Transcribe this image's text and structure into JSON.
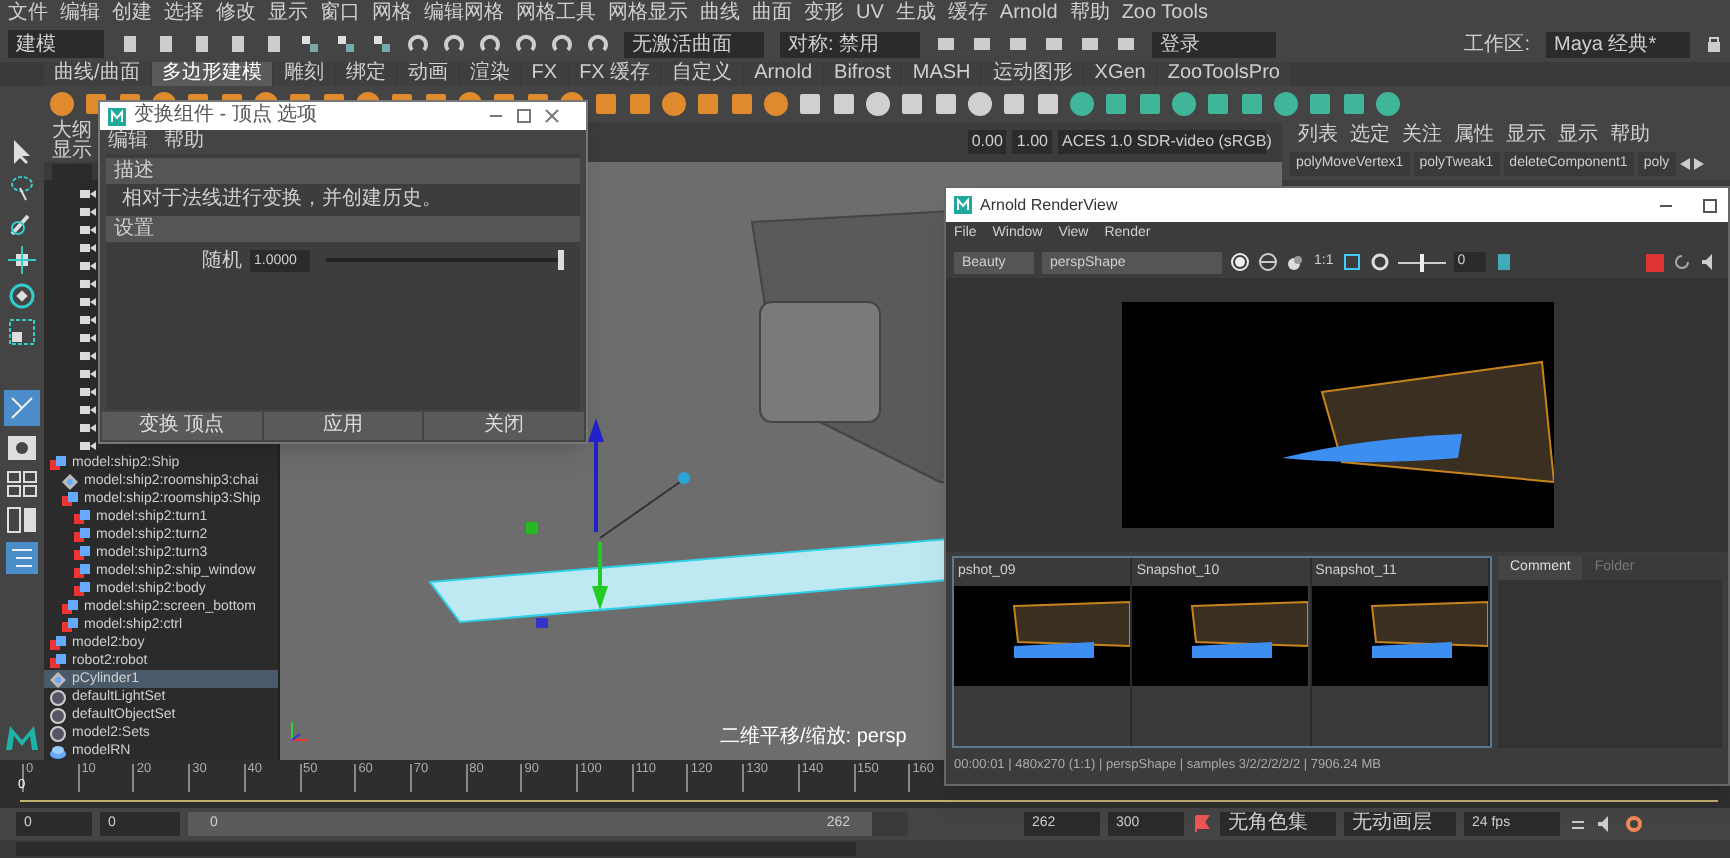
{
  "menu_bar": [
    "文件",
    "编辑",
    "创建",
    "选择",
    "修改",
    "显示",
    "窗口",
    "网格",
    "编辑网格",
    "网格工具",
    "网格显示",
    "曲线",
    "曲面",
    "变形",
    "UV",
    "生成",
    "缓存",
    "Arnold",
    "帮助",
    "Zoo Tools"
  ],
  "status_line": {
    "mode": "建模",
    "surface": "无激活曲面",
    "symmetry": "对称: 禁用",
    "login": "登录",
    "workspace_label": "工作区:",
    "workspace": "Maya 经典*"
  },
  "shelf_tabs": [
    {
      "label": "曲线/曲面",
      "selected": false
    },
    {
      "label": "多边形建模",
      "selected": true
    },
    {
      "label": "雕刻",
      "selected": false
    },
    {
      "label": "绑定",
      "selected": false
    },
    {
      "label": "动画",
      "selected": false
    },
    {
      "label": "渲染",
      "selected": false
    },
    {
      "label": "FX",
      "selected": false
    },
    {
      "label": "FX 缓存",
      "selected": false
    },
    {
      "label": "自定义",
      "selected": false
    },
    {
      "label": "Arnold",
      "selected": false
    },
    {
      "label": "Bifrost",
      "selected": false
    },
    {
      "label": "MASH",
      "selected": false
    },
    {
      "label": "运动图形",
      "selected": false
    },
    {
      "label": "XGen",
      "selected": false
    },
    {
      "label": "ZooToolsPro",
      "selected": false
    }
  ],
  "outliner": {
    "title": "大纲",
    "menu": "显示",
    "items": [
      {
        "label": "model:ship2:Ship",
        "kind": "transform",
        "selected": false,
        "children": [
          {
            "label": "model:ship2:roomship3:chai",
            "kind": "group",
            "selected": false
          },
          {
            "label": "model:ship2:roomship3:Ship",
            "kind": "transform",
            "selected": false,
            "children": [
              {
                "label": "model:ship2:turn1",
                "kind": "transform",
                "selected": false
              },
              {
                "label": "model:ship2:turn2",
                "kind": "transform",
                "selected": false
              },
              {
                "label": "model:ship2:turn3",
                "kind": "transform",
                "selected": false
              },
              {
                "label": "model:ship2:ship_window",
                "kind": "transform",
                "selected": false
              },
              {
                "label": "model:ship2:body",
                "kind": "transform",
                "selected": false
              }
            ]
          },
          {
            "label": "model:ship2:screen_bottom",
            "kind": "transform",
            "selected": false
          },
          {
            "label": "model:ship2:ctrl",
            "kind": "transform",
            "selected": false
          }
        ]
      },
      {
        "label": "model2:boy",
        "kind": "transform",
        "selected": false
      },
      {
        "label": "robot2:robot",
        "kind": "transform",
        "selected": false
      },
      {
        "label": "pCylinder1",
        "kind": "group",
        "selected": true
      },
      {
        "label": "defaultLightSet",
        "kind": "set",
        "selected": false
      },
      {
        "label": "defaultObjectSet",
        "kind": "set",
        "selected": false
      },
      {
        "label": "model2:Sets",
        "kind": "set",
        "selected": false
      },
      {
        "label": "modelRN",
        "kind": "reference",
        "selected": false
      }
    ]
  },
  "viewport": {
    "exposure": "0.00",
    "gamma": "1.00",
    "color_space": "ACES 1.0 SDR-video (sRGB)",
    "camera_label": "二维平移/缩放: persp"
  },
  "channel_box": {
    "menu": [
      "列表",
      "选定",
      "关注",
      "属性",
      "显示",
      "显示",
      "帮助"
    ],
    "tabs": [
      "polyMoveVertex1",
      "polyTweak1",
      "deleteComponent1",
      "poly"
    ]
  },
  "transform_dialog": {
    "title": "变换组件 - 顶点 选项",
    "menu": [
      "编辑",
      "帮助"
    ],
    "description_header": "描述",
    "description": "相对于法线进行变换，并创建历史。",
    "settings_header": "设置",
    "random_label": "随机",
    "random_value": "1.0000",
    "level": 1,
    "buttons": [
      "变换 顶点",
      "应用",
      "关闭"
    ]
  },
  "render_view": {
    "title": "Arnold RenderView",
    "menu": [
      "File",
      "Window",
      "View",
      "Render"
    ],
    "aov": "Beauty",
    "camera": "perspShape",
    "ratio": "1:1",
    "exposure": "0",
    "level": 0.5,
    "snapshots": [
      {
        "label": "pshot_09"
      },
      {
        "label": "Snapshot_10"
      },
      {
        "label": "Snapshot_11"
      }
    ],
    "tabs": [
      {
        "label": "Comment",
        "selected": true
      },
      {
        "label": "Folder",
        "selected": false
      }
    ],
    "status": "00:00:01 | 480x270 (1:1) | perspShape  | samples 3/2/2/2/2/2 | 7906.24 MB"
  },
  "time_slider": {
    "ticks": [
      "0",
      "10",
      "20",
      "30",
      "40",
      "50",
      "60",
      "70",
      "80",
      "90",
      "100",
      "110",
      "120",
      "130",
      "140",
      "150",
      "160"
    ],
    "current": "0"
  },
  "range_slider": {
    "start": "0",
    "playback_start": "0",
    "handle_start": "0",
    "handle_end": "262",
    "playback_end": "262",
    "end": "300",
    "level": 0.95,
    "character_set": "无角色集",
    "anim_layer": "无动画层",
    "fps": "24 fps"
  }
}
